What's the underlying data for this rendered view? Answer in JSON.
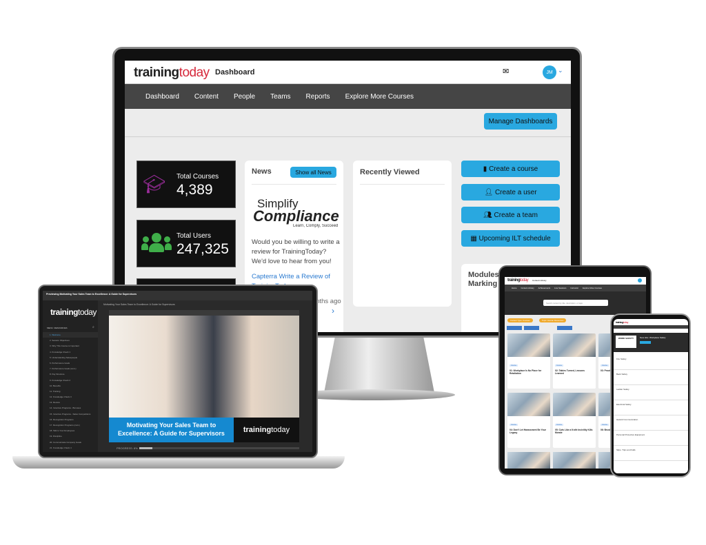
{
  "monitor": {
    "logo": {
      "part1": "training",
      "part2": "today"
    },
    "page_title": "Dashboard",
    "user_initials": "JM",
    "nav": [
      "Dashboard",
      "Content",
      "People",
      "Teams",
      "Reports",
      "Explore More Courses"
    ],
    "manage_dashboards": "Manage Dashboards",
    "stats": [
      {
        "label": "Total Courses",
        "value": "4,389",
        "icon": "graduation-cap-icon",
        "color": "#9b2d9b"
      },
      {
        "label": "Total Users",
        "value": "247,325",
        "icon": "users-icon",
        "color": "#3fae49"
      }
    ],
    "news": {
      "title": "News",
      "show_all": "Show all News",
      "brand_line1": "Simplify",
      "brand_line2": "Compliance",
      "brand_tagline": "Learn, Comply, Succeed",
      "body": "Would you be willing to write a review for TrainingToday? We'd love to hear from you!",
      "link": "Capterra Write a Review of TrainingToday",
      "time": "months ago"
    },
    "recently_viewed": {
      "title": "Recently Viewed"
    },
    "actions": [
      "Create a course",
      "Create a user",
      "Create a team",
      "Upcoming ILT schedule"
    ],
    "modules": {
      "title": "Modules Marking"
    },
    "accent": "#29a8e0"
  },
  "laptop": {
    "window_title": "Previewing Motivating Your Sales Team to Excellence: A Guide for Supervisors",
    "logo": {
      "part1": "training",
      "part2": "today"
    },
    "menu_tabs": [
      "MENU",
      "RESOURCES"
    ],
    "menu": [
      "1. Welcome",
      "2. Session Objectives",
      "3. Why This Course is Important",
      "4. Knowledge Check 1",
      "5. Understanding Salespeople",
      "6. Performance Goals",
      "7. Performance Goals (cont.)",
      "8. Pay Structure",
      "9. Knowledge Check 2",
      "10. Benefits",
      "11. Training",
      "12. Knowledge Check 3",
      "13. Review",
      "14. Incentive Programs - Bonuses",
      "15. Incentive Programs - Sales Competitions",
      "16. Recognition Programs",
      "17. Recognition Programs (cont.)",
      "18. Talk to Your Employees",
      "19. Discipline",
      "20. Communicate Company Goals",
      "21. Knowledge Check 4"
    ],
    "player_title": "Motivating Your Sales Team to Excellence: A Guide for Supervisors",
    "slide_title": "Motivating Your Sales Team to Excellence: A Guide for Supervisors",
    "progress": "PROGRESS: 8%",
    "progress_value": 8
  },
  "tablet": {
    "logo": {
      "part1": "training",
      "part2": "today"
    },
    "page_title": "Content Library",
    "nav": [
      "Home",
      "Content Library",
      "Achievements",
      "Live Sessions",
      "Instructor",
      "Explore More Courses"
    ],
    "search_placeholder": "Search content by title, description, or tags",
    "chips": [
      "Content Type: Courses",
      "Topic: Human Resources"
    ],
    "cards": [
      {
        "tag": "Course",
        "title": "01: Workplace Is No Place for Retaliation"
      },
      {
        "tag": "Course",
        "title": "02: Tables Turned, Lessons Learned"
      },
      {
        "tag": "Course",
        "title": "03: Proof"
      },
      {
        "tag": "Course",
        "title": "04: Don't Let Harassment Be Your Legacy"
      },
      {
        "tag": "Course",
        "title": "05: Cuts Like a Knife Incivility Kills Morale"
      },
      {
        "tag": "Course",
        "title": "06: Brush"
      }
    ]
  },
  "phone": {
    "logo": {
      "part1": "training",
      "part2": "today"
    },
    "course_title": "New Hire: Workplace Safety",
    "badge": "WORK SAFETY",
    "items": [
      "Fire Safety",
      "Back Safety",
      "Ladder Safety",
      "Electrical Safety",
      "Hazard Communication",
      "Personal Protective Equipment",
      "Slips, Trips and Falls"
    ]
  }
}
